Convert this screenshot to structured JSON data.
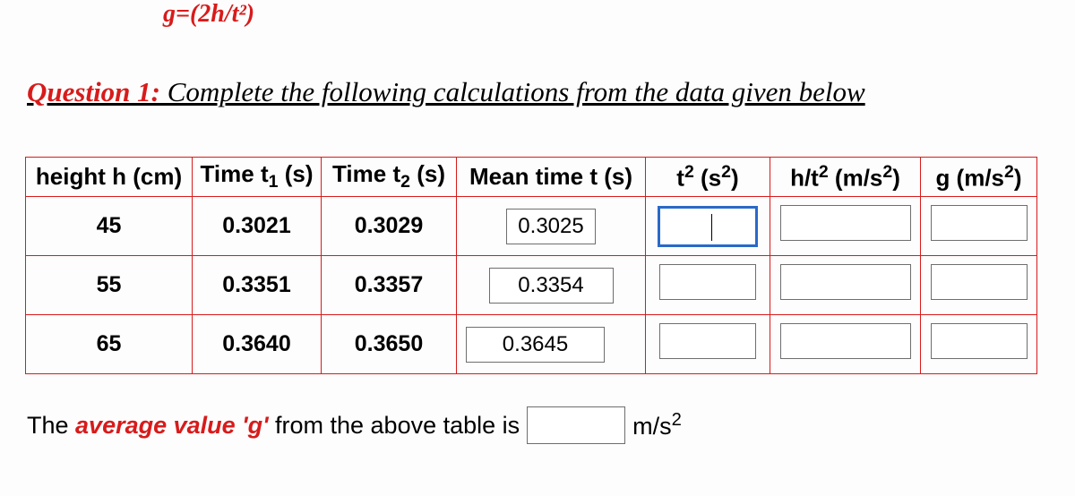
{
  "formula": "g=(2h/t²)",
  "question": {
    "label": "Question 1:",
    "text": " Complete the following calculations from the data given below"
  },
  "headers": {
    "h": "height h (cm)",
    "t1_pre": "Time t",
    "t1_sub": "1",
    "t1_post": " (s)",
    "t2_pre": "Time t",
    "t2_sub": "2",
    "t2_post": " (s)",
    "mt": "Mean time t (s)",
    "tsq_pre": "t",
    "tsq_mid": " (s",
    "tsq_end": ")",
    "ht_pre": "h/t",
    "ht_mid": " (m/s",
    "ht_end": ")",
    "g_pre": "g (m/s",
    "g_end": ")"
  },
  "rows": [
    {
      "h": "45",
      "t1": "0.3021",
      "t2": "0.3029",
      "mt": "0.3025"
    },
    {
      "h": "55",
      "t1": "0.3351",
      "t2": "0.3357",
      "mt": "0.3354"
    },
    {
      "h": "65",
      "t1": "0.3640",
      "t2": "0.3650",
      "mt": "0.3645"
    }
  ],
  "avg": {
    "pre": "The ",
    "highlight": "average value 'g'",
    "post1": " from the above table is ",
    "unit_pre": "m/s",
    "unit_sup": "2"
  },
  "sup2": "2"
}
